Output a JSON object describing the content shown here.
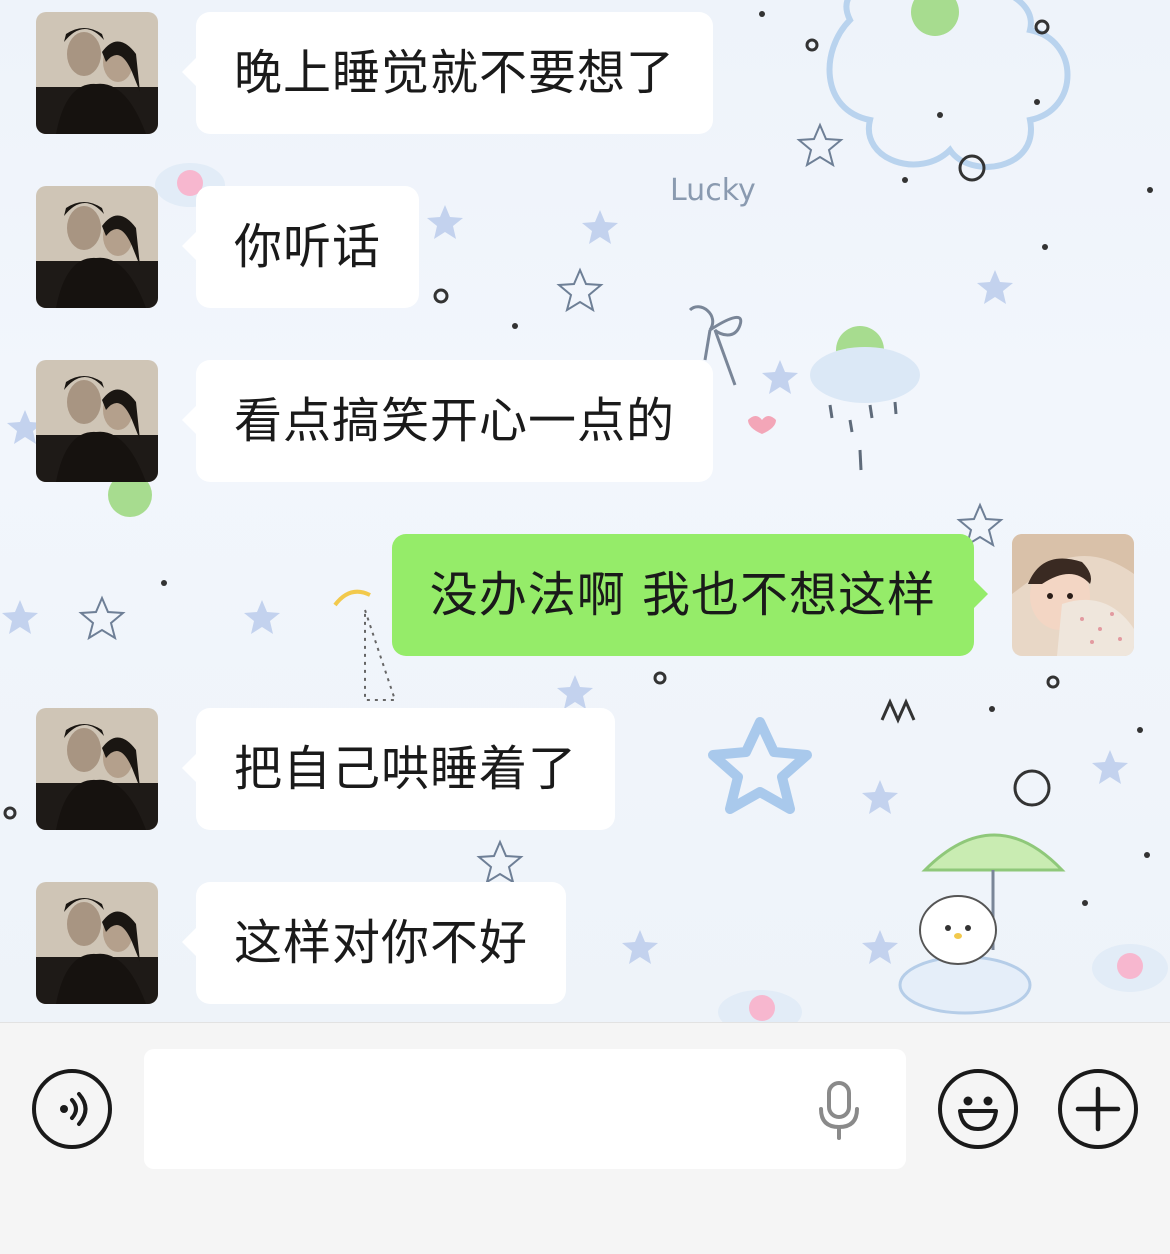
{
  "messages": [
    {
      "direction": "in",
      "text": "晚上睡觉就不要想了",
      "avatar": "couple-avatar"
    },
    {
      "direction": "in",
      "text": "你听话",
      "avatar": "couple-avatar"
    },
    {
      "direction": "in",
      "text": "看点搞笑开心一点的",
      "avatar": "couple-avatar"
    },
    {
      "direction": "out",
      "text": "没办法啊 我也不想这样",
      "avatar": "girl-avatar"
    },
    {
      "direction": "in",
      "text": "把自己哄睡着了",
      "avatar": "couple-avatar"
    },
    {
      "direction": "in",
      "text": "这样对你不好",
      "avatar": "couple-avatar"
    }
  ],
  "input": {
    "value": "",
    "placeholder": ""
  },
  "background": {
    "decoration_text": "Lucky"
  },
  "icons": {
    "voice": "voice-icon",
    "mic": "microphone-icon",
    "emoji": "emoji-icon",
    "plus": "plus-icon"
  },
  "colors": {
    "outgoing_bubble": "#95ec69",
    "incoming_bubble": "#ffffff",
    "input_bar": "#f5f5f5"
  }
}
